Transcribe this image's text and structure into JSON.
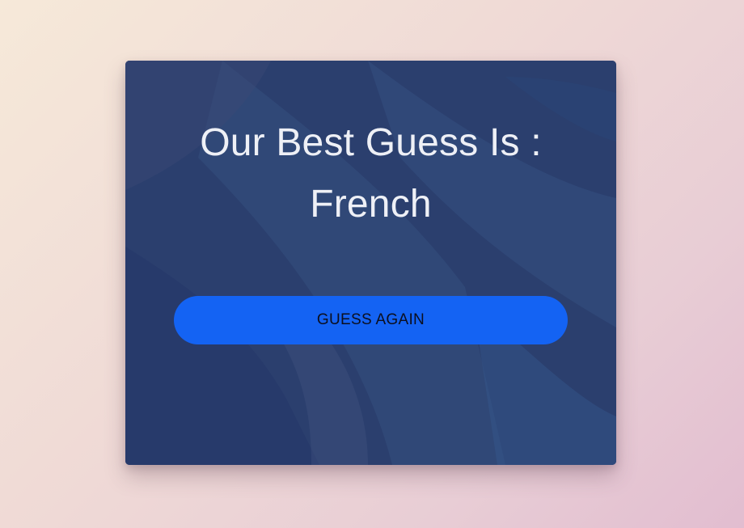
{
  "result": {
    "heading": "Our Best Guess Is :",
    "language": "French"
  },
  "actions": {
    "guess_again_label": "GUESS AGAIN"
  },
  "colors": {
    "page_gradient_start": "#f6e9d9",
    "page_gradient_end": "#e2bdd0",
    "card_background": "#2c4272",
    "button_background": "#1463f3",
    "title_text": "#eef0f6"
  }
}
